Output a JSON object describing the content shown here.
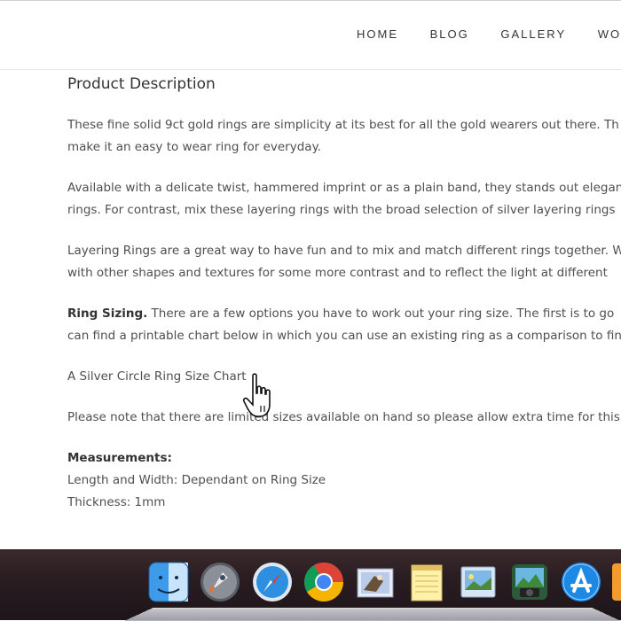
{
  "nav": {
    "items": [
      "HOME",
      "BLOG",
      "GALLERY",
      "WORKS"
    ]
  },
  "product": {
    "heading": "Product Description",
    "paragraphs": [
      [
        "These fine solid 9ct gold rings are simplicity at its best for all the gold wearers out there. Th",
        "make it an easy to wear ring for everyday."
      ],
      [
        "Available with a delicate twist, hammered imprint or as a plain band, they stands out elegan",
        "rings. For contrast, mix these layering rings with the broad selection of silver layering rings"
      ],
      [
        "Layering Rings are a great way to have fun and to mix and match different rings together. W",
        "with other shapes and textures for some more contrast and to reflect the light at different"
      ]
    ],
    "ring_sizing_label": "Ring Sizing.",
    "ring_sizing_text_1": " There are a few options you have to work out your ring size. The first is to go",
    "ring_sizing_text_2": "can find a printable chart below in which you can use an existing ring as a comparison to fin",
    "chart_link": "A Silver Circle Ring Size Chart",
    "note": "Please note that there are limited sizes available on hand so please allow extra time for this",
    "measurements_label": "Measurements:",
    "length_width": "Length and Width: Dependant on Ring Size",
    "thickness": "Thickness: 1mm"
  },
  "dock": {
    "icons": [
      "finder-icon",
      "launchpad-icon",
      "safari-icon",
      "chrome-icon",
      "mail-icon",
      "notes-icon",
      "preview-icon",
      "photo-booth-icon",
      "app-store-icon"
    ]
  }
}
